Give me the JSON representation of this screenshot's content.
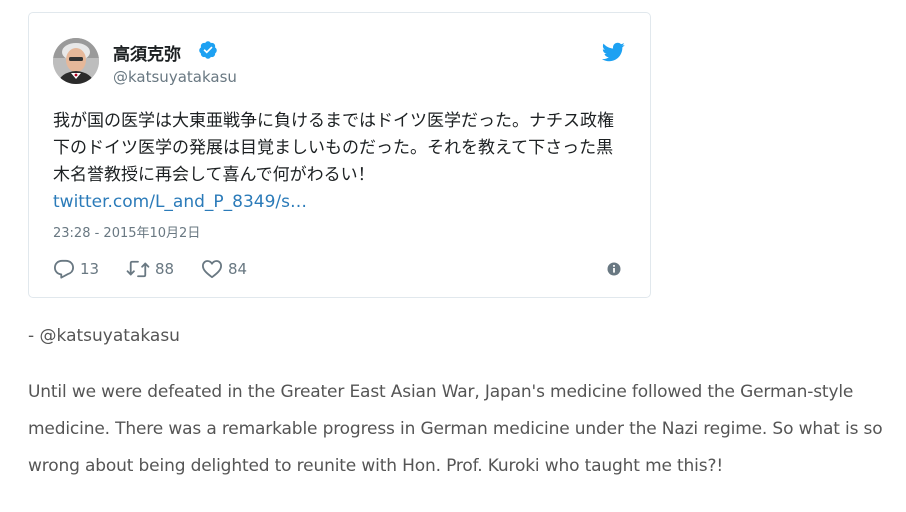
{
  "tweet": {
    "author": {
      "display_name": "高須克弥",
      "handle": "@katsuyatakasu",
      "verified": true
    },
    "text": "我が国の医学は大東亜戦争に負けるまではドイツ医学だった。ナチス政権下のドイツ医学の発展は目覚ましいものだった。それを教えて下さった黒木名誉教授に再会して喜んで何がわるい！ ",
    "link": "twitter.com/L_and_P_8349/s…",
    "timestamp": "23:28 - 2015年10月2日",
    "stats": {
      "replies": "13",
      "retweets": "88",
      "likes": "84"
    },
    "icons": {
      "brand": "twitter-bird-icon",
      "verified": "verified-badge-icon",
      "reply": "reply-icon",
      "retweet": "retweet-icon",
      "like": "heart-icon",
      "info": "info-icon"
    },
    "colors": {
      "brand_blue": "#1da1f2",
      "link_blue": "#2b7bb9",
      "meta_gray": "#697882"
    }
  },
  "attribution": "- @katsuyatakasu",
  "translation": "Until we were defeated in the Greater East Asian War, Japan's medicine followed the German-style medicine. There was a remarkable progress in German medicine under the Nazi regime. So what is so wrong about being delighted to reunite with Hon. Prof. Kuroki who taught me this?!"
}
